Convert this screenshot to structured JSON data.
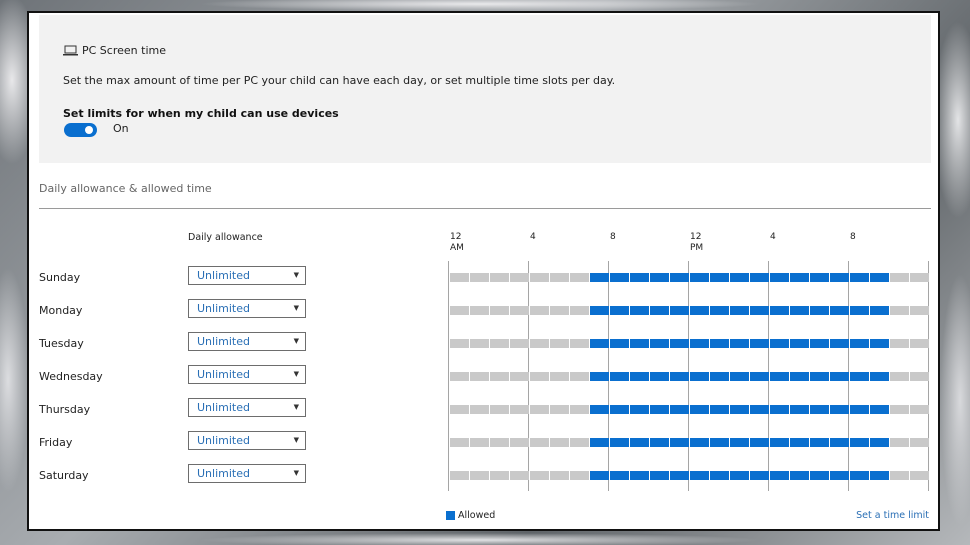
{
  "screen_time": {
    "title": "PC Screen time",
    "description": "Set the max amount of time per PC your child can have each day, or set multiple time slots per day.",
    "limits_label": "Set limits for when my child can use devices",
    "toggle_state": "On",
    "toggle_on": true
  },
  "schedule": {
    "section_title": "Daily allowance & allowed time",
    "allowance_header": "Daily allowance",
    "hour_labels": [
      {
        "line1": "12",
        "line2": "AM"
      },
      {
        "line1": "4",
        "line2": ""
      },
      {
        "line1": "8",
        "line2": ""
      },
      {
        "line1": "12",
        "line2": "PM"
      },
      {
        "line1": "4",
        "line2": ""
      },
      {
        "line1": "8",
        "line2": ""
      }
    ],
    "allowed_start_hour": 7,
    "allowed_end_hour": 22,
    "days": [
      {
        "name": "Sunday",
        "allowance": "Unlimited"
      },
      {
        "name": "Monday",
        "allowance": "Unlimited"
      },
      {
        "name": "Tuesday",
        "allowance": "Unlimited"
      },
      {
        "name": "Wednesday",
        "allowance": "Unlimited"
      },
      {
        "name": "Thursday",
        "allowance": "Unlimited"
      },
      {
        "name": "Friday",
        "allowance": "Unlimited"
      },
      {
        "name": "Saturday",
        "allowance": "Unlimited"
      }
    ],
    "legend_label": "Allowed",
    "set_limit_link": "Set a time limit"
  },
  "colors": {
    "allowed": "#0a6fcf",
    "blocked": "#c9c9c9",
    "panel_bg": "#f2f2f2",
    "link": "#2a6fb5"
  }
}
